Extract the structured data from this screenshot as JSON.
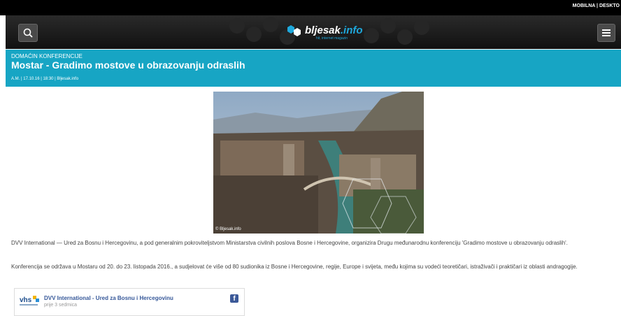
{
  "topbar": {
    "mobile_label": "MOBILNA",
    "separator": "|",
    "desktop_label": "DESKTO"
  },
  "header": {
    "logo_text": "bljesak",
    "logo_tld": ".info",
    "logo_tagline": "hit, internet magazin"
  },
  "article": {
    "kicker": "DOMAĆIN KONFERENCIJE",
    "title": "Mostar - Gradimo mostove u obrazovanju odraslih",
    "meta": "A.M. | 17.10.16 | 18:30 | Bljesak.info",
    "photo_credit": "© Bljesak.info",
    "paragraphs": [
      "DVV International — Ured za Bosnu i Hercegovinu, a pod generalnim pokroviteljstvom Ministarstva civilnih poslova Bosne i Hercegovine, organizira Drugu međunarodnu konferenciju 'Gradimo mostove u obrazovanju odraslih'.",
      "Konferencija se održava u Mostaru od 20. do 23. listopada 2016., a sudjelovat će više od 80 sudionika iz Bosne i Hercegovine, regije, Europe i svijeta, među kojima su vodeći teoretičari, istraživači i praktičari iz oblasti andragogije."
    ]
  },
  "facebook_embed": {
    "page_name": "DVV International - Ured za Bosnu i Hercegovinu",
    "time": "prije 3 sedmica",
    "logo_text": "vhs"
  },
  "colors": {
    "accent": "#17a5c4",
    "topbar": "#000000",
    "header": "#1a1a1a"
  },
  "icons": {
    "search": "search-icon",
    "menu": "hamburger-menu-icon",
    "facebook": "facebook-icon"
  }
}
